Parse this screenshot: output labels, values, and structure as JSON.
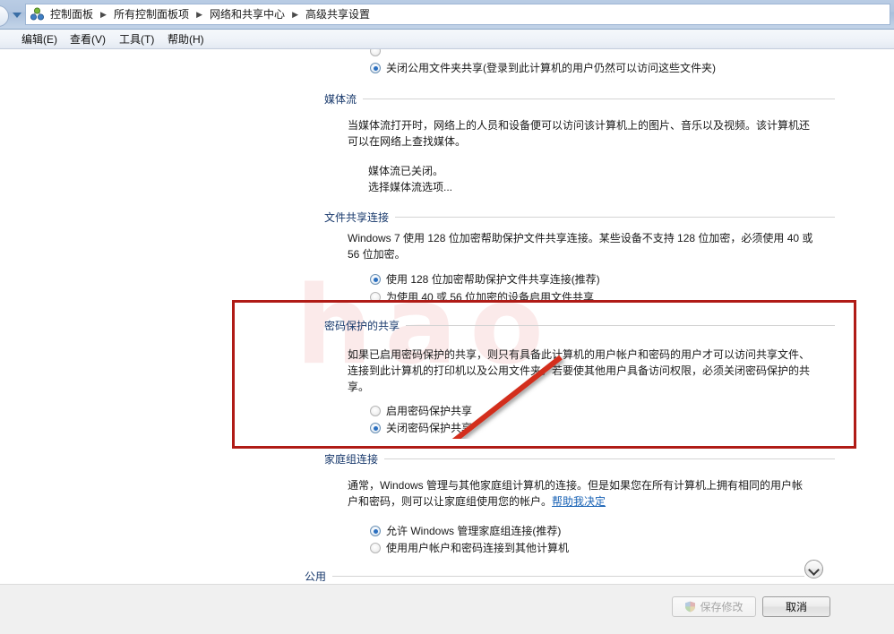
{
  "window": {
    "title": "高级共享设置"
  },
  "addressbar": {
    "back_icon": "back-circle-icon",
    "dropdown_icon": "chevron-down-icon",
    "network_icon": "network-sharing-center-icon",
    "breadcrumbs": [
      "控制面板",
      "所有控制面板项",
      "网络和共享中心",
      "高级共享设置"
    ]
  },
  "menubar": {
    "items": [
      {
        "label": "编辑(E)"
      },
      {
        "label": "查看(V)"
      },
      {
        "label": "工具(T)"
      },
      {
        "label": "帮助(H)"
      }
    ]
  },
  "content": {
    "watermark": "hao",
    "public_folder_partial": {
      "cut_option_label": "",
      "option_off_label": "关闭公用文件夹共享(登录到此计算机的用户仍然可以访问这些文件夹)",
      "option_off_selected": true
    },
    "media_streaming": {
      "heading": "媒体流",
      "description": "当媒体流打开时，网络上的人员和设备便可以访问该计算机上的图片、音乐以及视频。该计算机还可以在网络上查找媒体。",
      "status": "媒体流已关闭。",
      "link": "选择媒体流选项..."
    },
    "file_sharing_connections": {
      "heading": "文件共享连接",
      "description": "Windows 7 使用 128 位加密帮助保护文件共享连接。某些设备不支持 128 位加密，必须使用 40 或 56 位加密。",
      "options": [
        {
          "label": "使用 128 位加密帮助保护文件共享连接(推荐)",
          "selected": true
        },
        {
          "label": "为使用 40 或 56 位加密的设备启用文件共享",
          "selected": false
        }
      ]
    },
    "password_protected_sharing": {
      "heading": "密码保护的共享",
      "description": "如果已启用密码保护的共享，则只有具备此计算机的用户帐户和密码的用户才可以访问共享文件、连接到此计算机的打印机以及公用文件夹。若要使其他用户具备访问权限，必须关闭密码保护的共享。",
      "options": [
        {
          "label": "启用密码保护共享",
          "selected": false
        },
        {
          "label": "关闭密码保护共享",
          "selected": true
        }
      ],
      "annotation": {
        "box_color": "#b01b16",
        "arrow_color": "#d32f1e",
        "arrow_points_to": "关闭密码保护共享"
      }
    },
    "homegroup_connections": {
      "heading": "家庭组连接",
      "description_before_link": "通常，Windows 管理与其他家庭组计算机的连接。但是如果您在所有计算机上拥有相同的用户帐户和密码，则可以让家庭组使用您的帐户。",
      "link": "帮助我决定",
      "options": [
        {
          "label": "允许 Windows 管理家庭组连接(推荐)",
          "selected": true
        },
        {
          "label": "使用用户帐户和密码连接到其他计算机",
          "selected": false
        }
      ]
    },
    "public_section": {
      "heading": "公用",
      "expander_icon": "chevron-down-icon",
      "expanded": false
    }
  },
  "footer": {
    "save_label": "保存修改",
    "save_enabled": false,
    "save_icon": "uac-shield-icon",
    "cancel_label": "取消",
    "cancel_enabled": true
  }
}
